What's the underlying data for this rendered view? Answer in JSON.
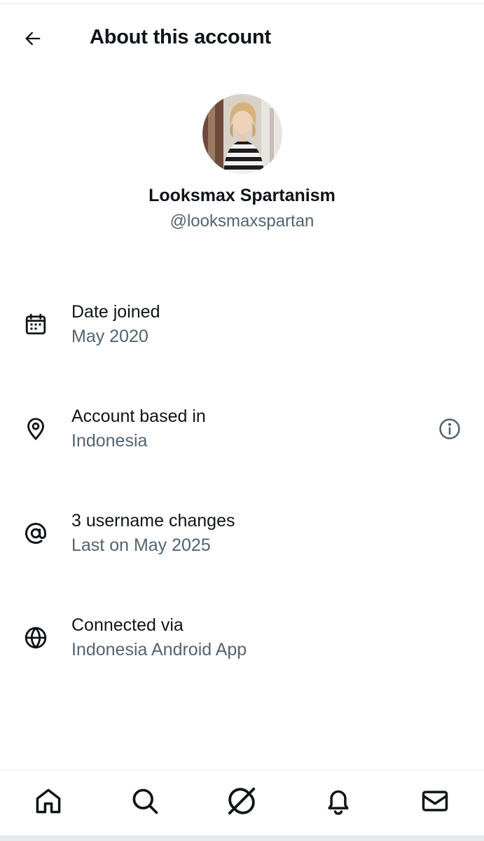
{
  "header": {
    "title": "About this account",
    "back_icon": "arrow-left-icon"
  },
  "profile": {
    "display_name": "Looksmax Spartanism",
    "handle": "@looksmaxspartan",
    "avatar_alt": "Profile photo"
  },
  "rows": [
    {
      "icon": "calendar-icon",
      "label": "Date joined",
      "value": "May 2020"
    },
    {
      "icon": "location-pin-icon",
      "label": "Account based in",
      "value": "Indonesia",
      "info_icon": "info-icon"
    },
    {
      "icon": "at-sign-icon",
      "label": "3 username changes",
      "value": "Last on May 2025"
    },
    {
      "icon": "globe-icon",
      "label": "Connected via",
      "value": "Indonesia Android App"
    }
  ],
  "bottom_nav": [
    "home-icon",
    "search-icon",
    "grok-icon",
    "notifications-bell-icon",
    "messages-envelope-icon"
  ],
  "colors": {
    "text_primary": "#0f1419",
    "text_secondary": "#536471",
    "divider": "#e6e9ec"
  }
}
